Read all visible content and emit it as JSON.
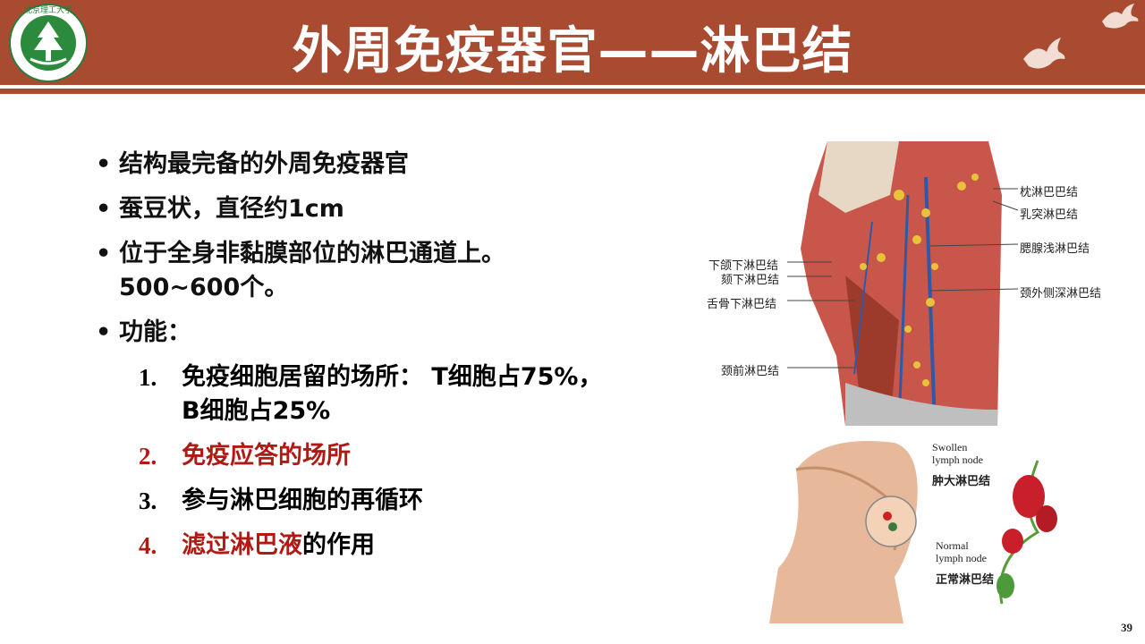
{
  "header": {
    "title": "外周免疫器官——淋巴结",
    "logo_text": "北京理工大学",
    "logo_ring": "BEIJING INSTITUTE OF TECHNOLOGY",
    "logo_year": "1940",
    "brand_color": "#a94b31"
  },
  "bullets": [
    {
      "text": "结构最完备的外周免疫器官"
    },
    {
      "text": "蚕豆状，直径约1cm"
    },
    {
      "text": "位于全身非黏膜部位的淋巴通道上。",
      "line2": "500~600个。"
    },
    {
      "text": "功能："
    }
  ],
  "functions": [
    {
      "num": "1.",
      "text": "免疫细胞居留的场所： T细胞占75%，",
      "line2": "B细胞占25%",
      "highlight": ""
    },
    {
      "num": "2.",
      "text": "免疫应答的场所",
      "highlight": "all"
    },
    {
      "num": "3.",
      "text": "参与淋巴细胞的再循环",
      "highlight": ""
    },
    {
      "num": "4.",
      "text_red": "滤过淋巴液",
      "text_rest": "的作用",
      "highlight": "partial"
    }
  ],
  "neck_labels": {
    "left": [
      "下颌下淋巴结",
      "颏下淋巴结",
      "舌骨下淋巴结",
      "颈前淋巴结"
    ],
    "right": [
      "枕淋巴巴结",
      "乳突淋巴结",
      "腮腺浅淋巴结",
      "颈外侧深淋巴结"
    ]
  },
  "node_labels": {
    "swollen_en": "Swollen lymph node",
    "swollen_zh": "肿大淋巴结",
    "normal_en": "Normal lymph node",
    "normal_zh": "正常淋巴结"
  },
  "page_number": "39",
  "colors": {
    "accent_red": "#b11a14",
    "text": "#111111"
  }
}
